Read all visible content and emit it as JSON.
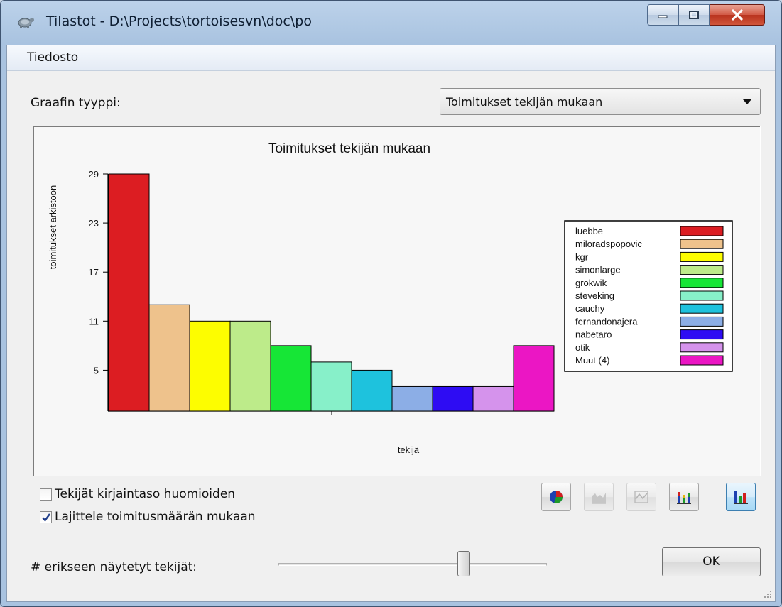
{
  "window": {
    "title": "Tilastot - D:\\Projects\\tortoisesvn\\doc\\po"
  },
  "menu": {
    "items": [
      "Tiedosto"
    ]
  },
  "graph_type": {
    "label": "Graafin tyyppi:",
    "selected": "Toimitukset tekijän mukaan"
  },
  "chart_data": {
    "type": "bar",
    "title": "Toimitukset tekijän mukaan",
    "xlabel": "tekijä",
    "ylabel": "toimitukset arkistoon",
    "yticks": [
      29,
      23,
      17,
      11,
      5
    ],
    "ylim": [
      0,
      29
    ],
    "categories": [
      "luebbe",
      "miloradspopovic",
      "kgr",
      "simonlarge",
      "grokwik",
      "steveking",
      "cauchy",
      "fernandonajera",
      "nabetaro",
      "otik",
      "Muut (4)"
    ],
    "values": [
      29,
      13,
      11,
      11,
      8,
      6,
      5,
      3,
      3,
      3,
      8
    ],
    "colors": [
      "#dc1d22",
      "#eec28c",
      "#fdfd00",
      "#bdeb8a",
      "#16e636",
      "#87f0c9",
      "#1ec2dd",
      "#8caee6",
      "#2e0cf3",
      "#d593ec",
      "#eb16c4"
    ],
    "legend_position": "right",
    "grid": false
  },
  "options": {
    "case_sensitive_label": "Tekijät kirjaintaso huomioiden",
    "case_sensitive_checked": false,
    "sort_label": "Lajittele toimitusmäärän mukaan",
    "sort_checked": true
  },
  "chart_type_buttons": [
    {
      "icon": "pie-chart-icon",
      "enabled": true,
      "active": false
    },
    {
      "icon": "area-chart-icon",
      "enabled": false,
      "active": false
    },
    {
      "icon": "line-chart-icon",
      "enabled": false,
      "active": false
    },
    {
      "icon": "stacked-bar-chart-icon",
      "enabled": true,
      "active": false
    },
    {
      "icon": "bar-chart-icon",
      "enabled": true,
      "active": true
    }
  ],
  "authors_slider": {
    "label": "# erikseen näytetyt tekijät:",
    "value_fraction": 0.69
  },
  "ok_button": {
    "label": "OK"
  }
}
